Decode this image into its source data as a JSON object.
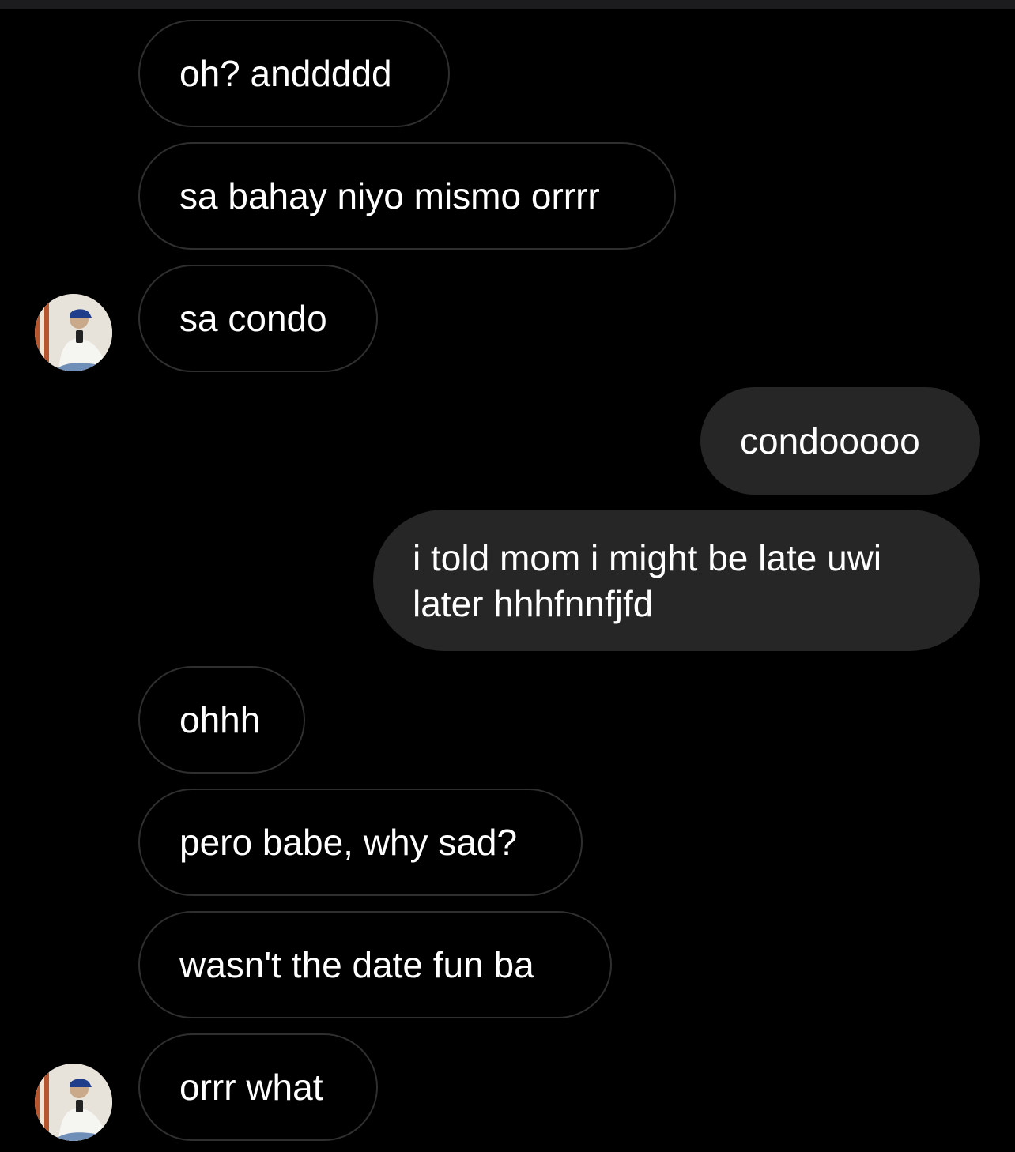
{
  "messages": [
    {
      "text": "oh? anddddd",
      "sender": "them"
    },
    {
      "text": "sa bahay niyo mismo orrrr",
      "sender": "them"
    },
    {
      "text": "sa condo",
      "sender": "them"
    },
    {
      "text": "condooooo",
      "sender": "me"
    },
    {
      "text": "i told mom i might be late uwi later hhhfnnfjfd",
      "sender": "me"
    },
    {
      "text": "ohhh",
      "sender": "them"
    },
    {
      "text": "pero babe, why sad?",
      "sender": "them"
    },
    {
      "text": "wasn't the date fun ba",
      "sender": "them"
    },
    {
      "text": "orrr what",
      "sender": "them"
    }
  ],
  "colors": {
    "background": "#000000",
    "incoming_border": "#2f2f2f",
    "outgoing_fill": "#262626",
    "text": "#ffffff"
  },
  "icons": {
    "avatar": "contact-avatar-icon"
  }
}
